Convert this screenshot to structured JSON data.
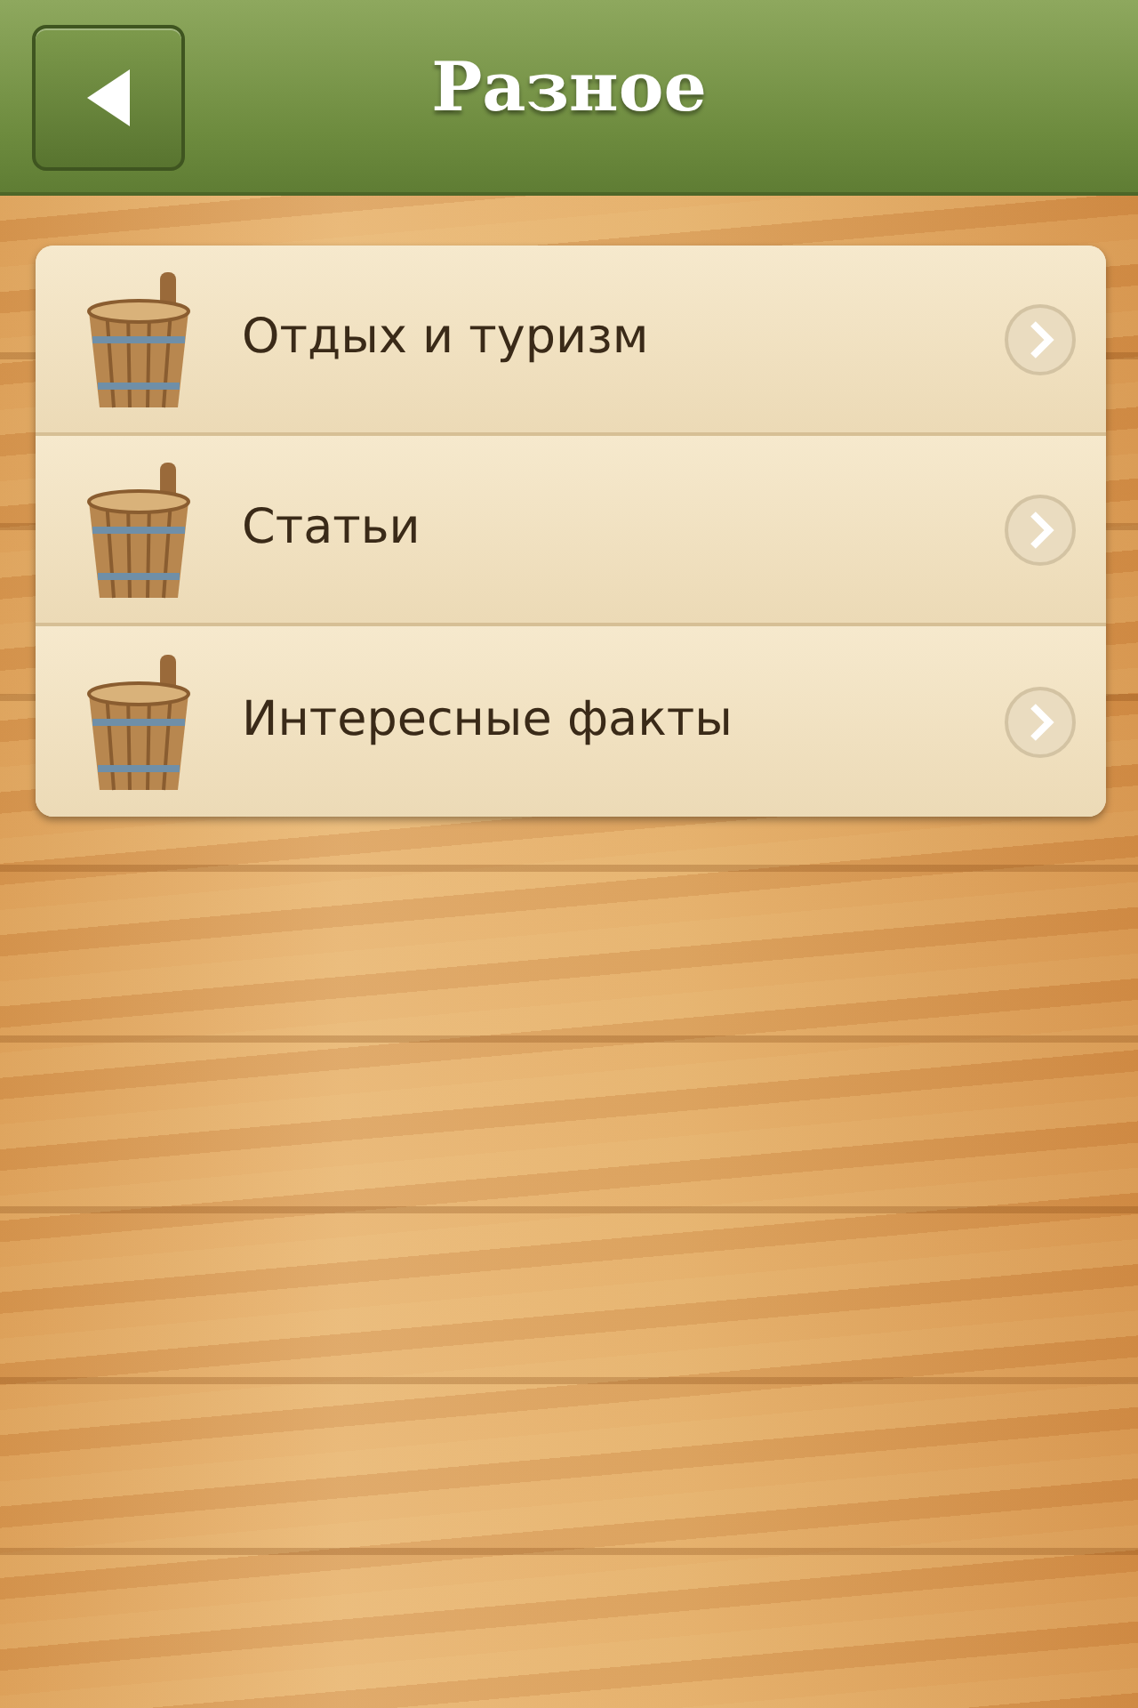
{
  "header": {
    "title": "Разное"
  },
  "items": [
    {
      "label": "Отдых и туризм"
    },
    {
      "label": "Статьи"
    },
    {
      "label": "Интересные факты"
    }
  ]
}
